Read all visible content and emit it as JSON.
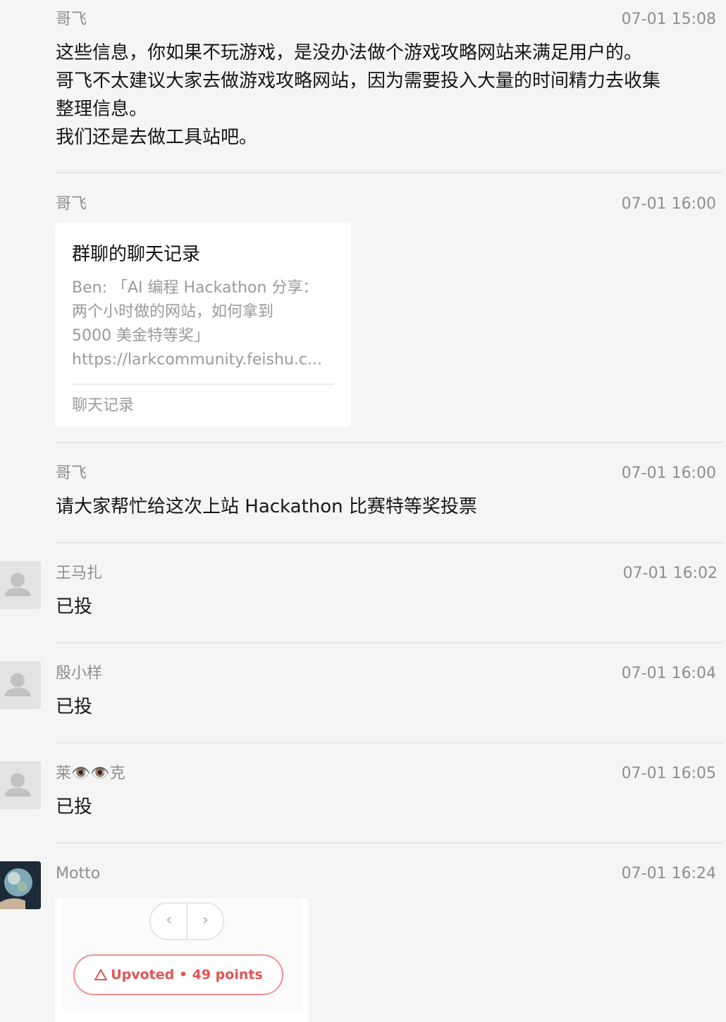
{
  "messages": [
    {
      "sender": "哥飞",
      "time": "07-01 15:08",
      "lines": [
        "这些信息，你如果不玩游戏，是没办法做个游戏攻略网站来满足用户的。",
        "哥飞不太建议大家去做游戏攻略网站，因为需要投入大量的时间精力去收集",
        "整理信息。",
        "我们还是去做工具站吧。"
      ]
    },
    {
      "sender": "哥飞",
      "time": "07-01 16:00",
      "card": {
        "title": "群聊的聊天记录",
        "lines": [
          "Ben: 「AI 编程 Hackathon 分享：",
          "两个小时做的网站，如何拿到",
          "5000 美金特等奖」",
          "https://larkcommunity.feishu.c..."
        ],
        "footer": "聊天记录"
      }
    },
    {
      "sender": "哥飞",
      "time": "07-01 16:00",
      "text": "请大家帮忙给这次上站 Hackathon 比赛特等奖投票"
    },
    {
      "sender": "王马扎",
      "time": "07-01 16:02",
      "text": "已投"
    },
    {
      "sender": "殷小样",
      "time": "07-01 16:04",
      "text": "已投"
    },
    {
      "sender": "莱👁️👁️克",
      "time": "07-01 16:05",
      "text": "已投"
    },
    {
      "sender": "Motto",
      "time": "07-01 16:24",
      "image": {
        "prev_glyph": "‹",
        "next_glyph": "›",
        "upvote_label": "Upvoted • 49 points",
        "upvote_icon": "triangle-up-icon"
      }
    }
  ],
  "colors": {
    "background": "#f5f5f5",
    "meta_text": "#8e8e8e",
    "body_text": "#151515",
    "upvote_accent": "#e05656"
  }
}
